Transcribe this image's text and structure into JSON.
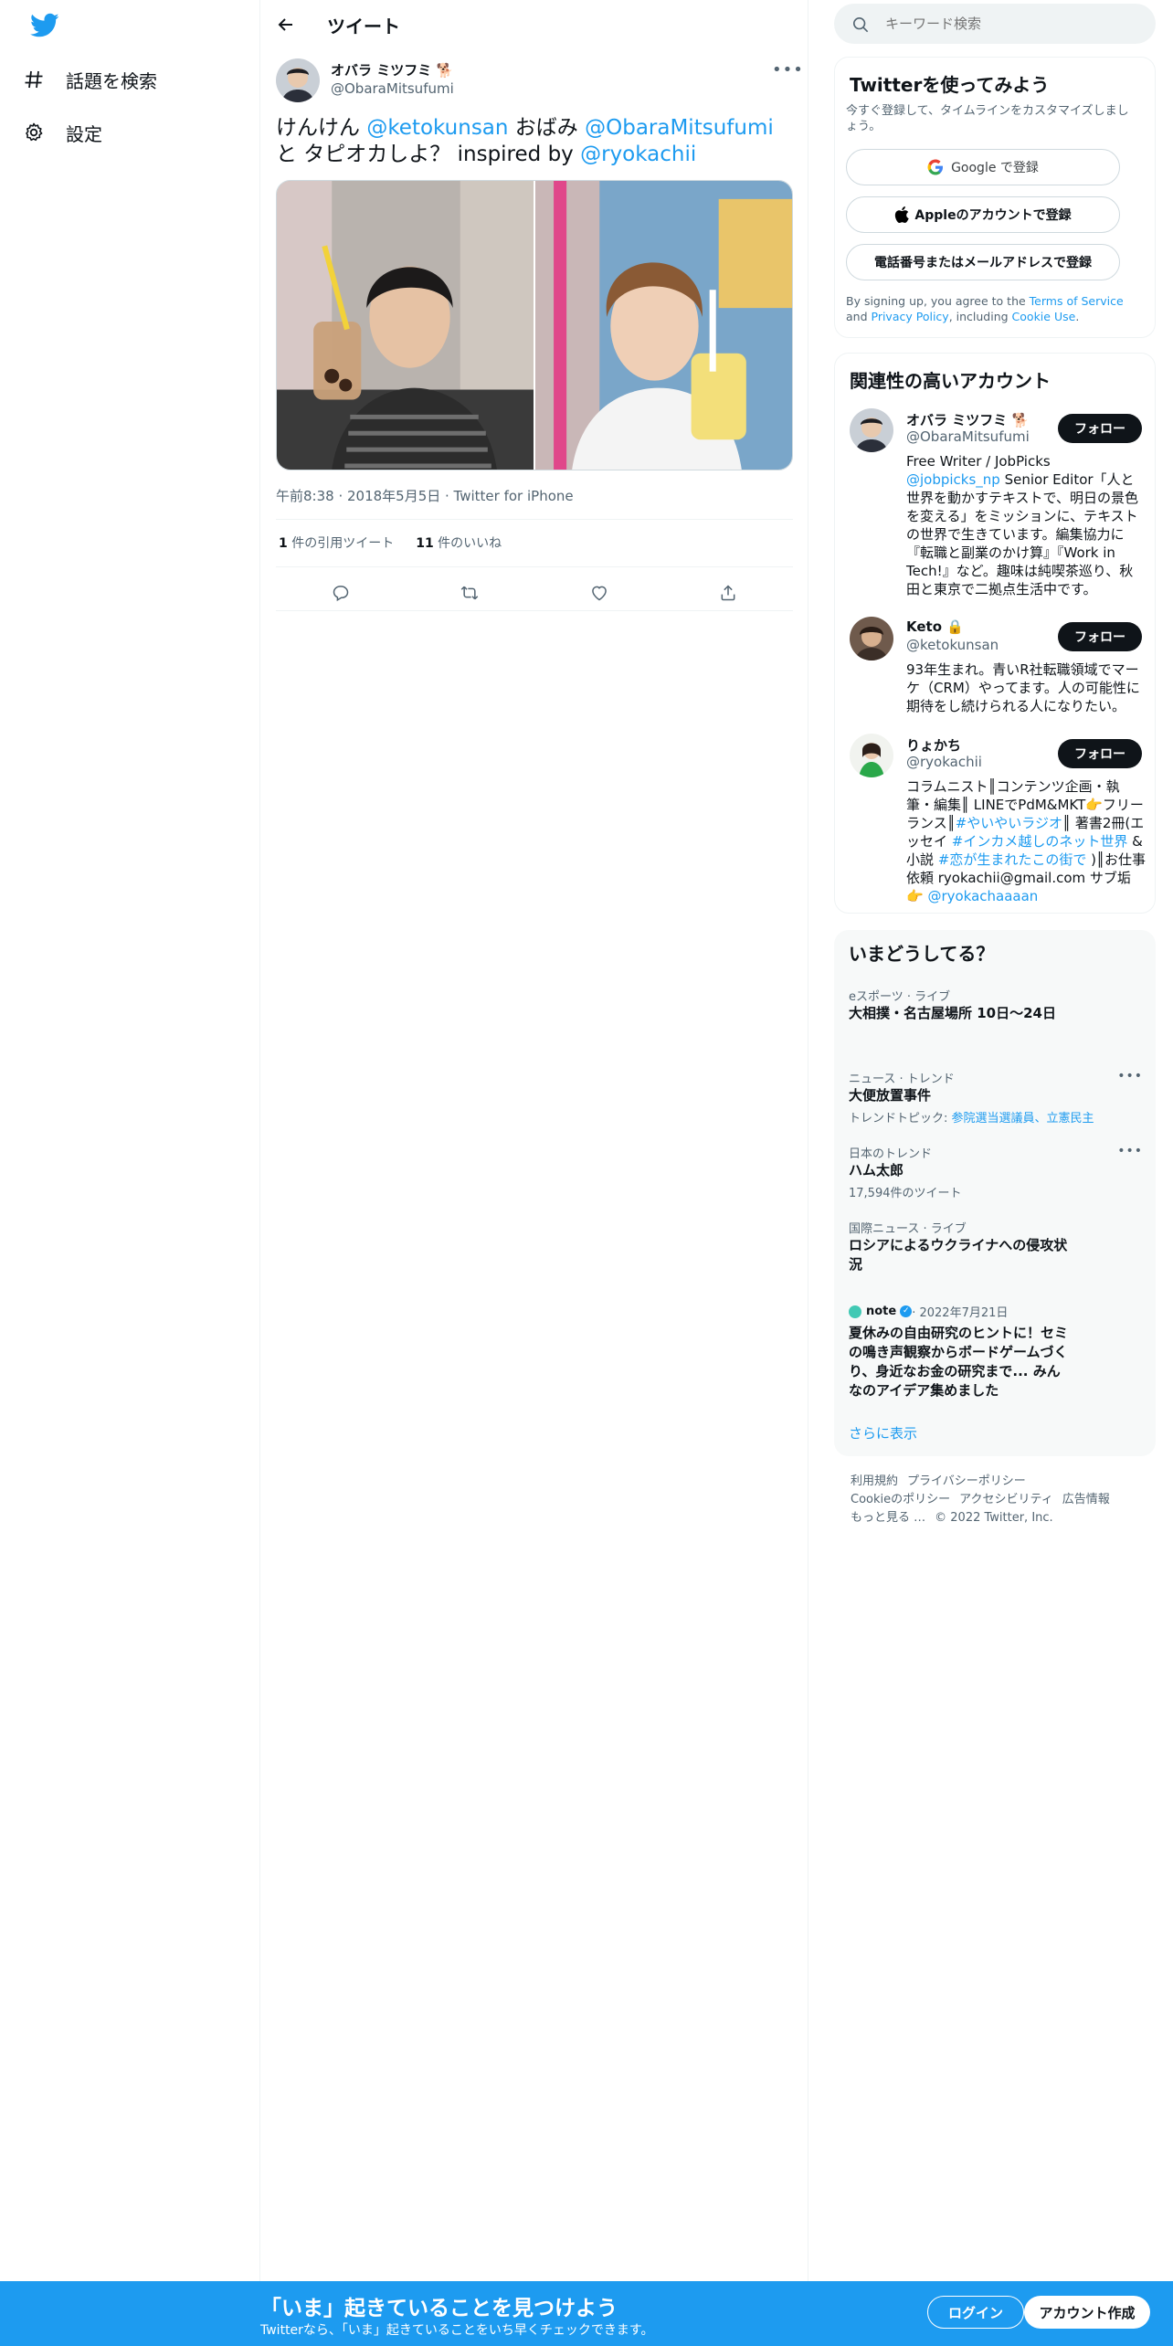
{
  "nav": {
    "explore_label": "話題を検索",
    "settings_label": "設定"
  },
  "header": {
    "title": "ツイート"
  },
  "tweet": {
    "author_name": "オバラ ミツフミ 🐕",
    "author_handle": "@ObaraMitsufumi",
    "text_parts": [
      "けんけん ",
      "@ketokunsan",
      " おばみ ",
      "@ObaraMitsufumi",
      " と タピオカしよ？ inspired by ",
      "@ryokachii"
    ],
    "timestamp": "午前8:38 · 2018年5月5日 · Twitter for iPhone",
    "quote_count": "1",
    "quote_label": "件の引用ツイート",
    "like_count": "11",
    "like_label": "件のいいね"
  },
  "search": {
    "placeholder": "キーワード検索"
  },
  "signup_card": {
    "title": "Twitterを使ってみよう",
    "subtitle": "今すぐ登録して、タイムラインをカスタマイズしましょう。",
    "google_label": "Google で登録",
    "apple_label": "Appleのアカウントで登録",
    "phone_label": "電話番号またはメールアドレスで登録",
    "legal_parts": [
      "By signing up, you agree to the ",
      "Terms of Service",
      " and ",
      "Privacy Policy",
      ", including ",
      "Cookie Use",
      "."
    ]
  },
  "related": {
    "title": "関連性の高いアカウント",
    "follow_label": "フォロー",
    "accounts": [
      {
        "name": "オバラ ミツフミ 🐕",
        "handle": "@ObaraMitsufumi",
        "bio_parts": [
          "Free Writer / JobPicks ",
          "@jobpicks_np",
          " Senior Editor「人と世界を動かすテキストで、明日の景色を変える」をミッションに、テキストの世界で生きています。編集協力に『転職と副業のかけ算』『Work in Tech!』など。趣味は純喫茶巡り、秋田と東京で二拠点生活中です。"
        ]
      },
      {
        "name": "Keto 🔒",
        "handle": "@ketokunsan",
        "bio": "93年生まれ。青いR社転職領域でマーケ（CRM）やってます。人の可能性に期待をし続けられる人になりたい。"
      },
      {
        "name": "りょかち",
        "handle": "@ryokachii",
        "bio_parts": [
          "コラムニスト║コンテンツ企画・執筆・編集║ LINEでPdM&MKT👉フリーランス║",
          "#やいやいラジオ",
          "║ 著書2冊(エッセイ ",
          "#インカメ越しのネット世界",
          " &小説 ",
          "#恋が生まれたこの街で",
          " )║お仕事依頼 ryokachii@gmail.com サブ垢👉 ",
          "@ryokachaaaan"
        ]
      }
    ]
  },
  "trends": {
    "title": "いまどうしてる？",
    "items": [
      {
        "category": "eスポーツ · ライブ",
        "title": "大相撲・名古屋場所 10日〜24日"
      },
      {
        "category": "ニュース · トレンド",
        "title": "大便放置事件",
        "sub_prefix": "トレンドトピック: ",
        "sub_links": "参院選当選議員、立憲民主"
      },
      {
        "category": "日本のトレンド",
        "title": "ハム太郎",
        "sub": "17,594件のツイート"
      },
      {
        "category": "国際ニュース · ライブ",
        "title": "ロシアによるウクライナへの侵攻状況"
      },
      {
        "source": "note",
        "date": " · 2022年7月21日",
        "title": "夏休みの自由研究のヒントに！セミの鳴き声観察からボードゲームづくり、身近なお金の研究まで... みんなのアイデア集めました"
      }
    ],
    "show_more": "さらに表示"
  },
  "footer": {
    "links": [
      "利用規約",
      "プライバシーポリシー",
      "Cookieのポリシー",
      "アクセシビリティ",
      "広告情報",
      "もっと見る …"
    ],
    "copyright": "© 2022 Twitter, Inc."
  },
  "banner": {
    "title": "「いま」起きていることを見つけよう",
    "subtitle": "Twitterなら、「いま」起きていることをいち早くチェックできます。",
    "login_label": "ログイン",
    "signup_label": "アカウント作成"
  },
  "colors": {
    "accent": "#1d9bf0",
    "text": "#0f1419",
    "muted": "#536471"
  }
}
